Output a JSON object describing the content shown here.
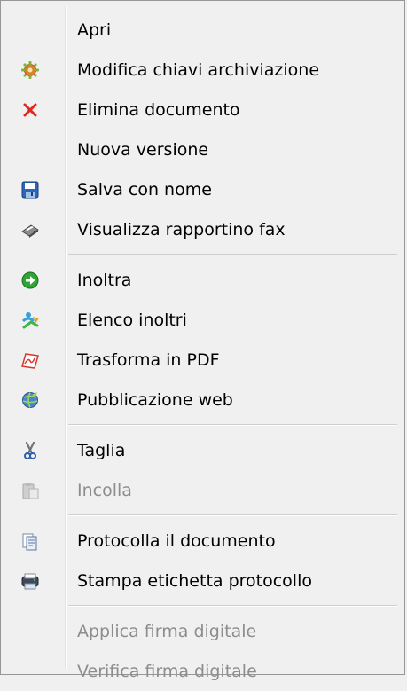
{
  "menu": {
    "groups": [
      [
        {
          "label": "Apri",
          "icon": "none",
          "disabled": false
        },
        {
          "label": "Modifica chiavi archiviazione",
          "icon": "gear-icon",
          "disabled": false
        },
        {
          "label": "Elimina documento",
          "icon": "delete-x-icon",
          "disabled": false
        },
        {
          "label": "Nuova versione",
          "icon": "none",
          "disabled": false
        },
        {
          "label": "Salva con nome",
          "icon": "floppy-disk-icon",
          "disabled": false
        },
        {
          "label": "Visualizza rapportino fax",
          "icon": "fax-icon",
          "disabled": false
        }
      ],
      [
        {
          "label": "Inoltra",
          "icon": "forward-arrow-icon",
          "disabled": false
        },
        {
          "label": "Elenco inoltri",
          "icon": "forward-list-icon",
          "disabled": false
        },
        {
          "label": "Trasforma in PDF",
          "icon": "pdf-icon",
          "disabled": false
        },
        {
          "label": "Pubblicazione web",
          "icon": "web-publish-icon",
          "disabled": false
        }
      ],
      [
        {
          "label": "Taglia",
          "icon": "scissors-icon",
          "disabled": false
        },
        {
          "label": "Incolla",
          "icon": "clipboard-icon",
          "disabled": true
        }
      ],
      [
        {
          "label": "Protocolla il documento",
          "icon": "protocol-document-icon",
          "disabled": false
        },
        {
          "label": "Stampa etichetta protocollo",
          "icon": "label-printer-icon",
          "disabled": false
        }
      ],
      [
        {
          "label": "Applica firma digitale",
          "icon": "none",
          "disabled": true
        },
        {
          "label": "Verifica firma digitale",
          "icon": "none",
          "disabled": true
        }
      ]
    ]
  },
  "colors": {
    "menu_background": "#f0f0f0",
    "text": "#000000",
    "disabled_text": "#8d8d8d",
    "delete_red": "#e0281c",
    "forward_green": "#2fa534"
  }
}
